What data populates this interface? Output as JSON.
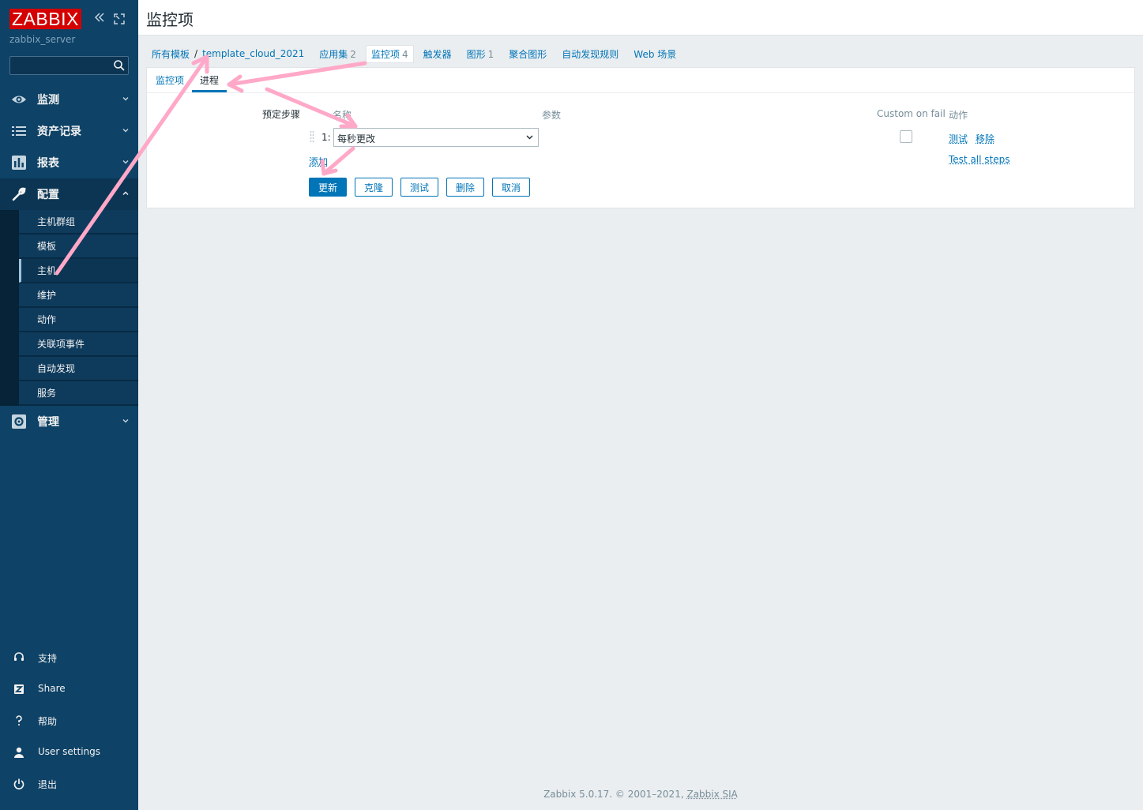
{
  "sidebar": {
    "logo": "ZABBIX",
    "server": "zabbix_server",
    "search_placeholder": "",
    "menu": [
      {
        "label": "监测",
        "icon": "eye-icon"
      },
      {
        "label": "资产记录",
        "icon": "list-icon"
      },
      {
        "label": "报表",
        "icon": "bar-chart-icon"
      },
      {
        "label": "配置",
        "icon": "wrench-icon"
      },
      {
        "label": "管理",
        "icon": "gear-icon"
      }
    ],
    "submenu": [
      "主机群组",
      "模板",
      "主机",
      "维护",
      "动作",
      "关联项事件",
      "自动发现",
      "服务"
    ],
    "bottom": [
      {
        "label": "支持",
        "icon": "headset-icon"
      },
      {
        "label": "Share",
        "icon": "zabbix-share-icon"
      },
      {
        "label": "帮助",
        "icon": "help-icon"
      },
      {
        "label": "User settings",
        "icon": "user-icon"
      },
      {
        "label": "退出",
        "icon": "power-icon"
      }
    ]
  },
  "header": {
    "title": "监控项"
  },
  "nav": {
    "all_templates": "所有模板",
    "separator": "/",
    "template": "template_cloud_2021",
    "tabs": [
      {
        "label": "应用集",
        "count": "2"
      },
      {
        "label": "监控项",
        "count": "4"
      },
      {
        "label": "触发器",
        "count": ""
      },
      {
        "label": "图形",
        "count": "1"
      },
      {
        "label": "聚合图形",
        "count": ""
      },
      {
        "label": "自动发现规则",
        "count": ""
      },
      {
        "label": "Web 场景",
        "count": ""
      }
    ]
  },
  "form": {
    "tabs": [
      "监控项",
      "进程"
    ],
    "preprocessing_label": "预定步骤",
    "columns": {
      "name": "名称",
      "params": "参数",
      "custom_on_fail": "Custom on fail",
      "action": "动作"
    },
    "step": {
      "num": "1:",
      "value": "每秒更改",
      "custom_on_fail": false
    },
    "step_actions": {
      "test": "测试",
      "remove": "移除"
    },
    "add": "添加",
    "test_all": "Test all steps",
    "buttons": {
      "update": "更新",
      "clone": "克隆",
      "test": "测试",
      "delete": "删除",
      "cancel": "取消"
    }
  },
  "footer": {
    "text": "Zabbix 5.0.17. © 2001–2021,",
    "link": "Zabbix SIA"
  },
  "colors": {
    "sidebar": "#0e4266",
    "accent": "#0275b8",
    "logo": "#d40000",
    "annotation": "#ffa8c8"
  }
}
